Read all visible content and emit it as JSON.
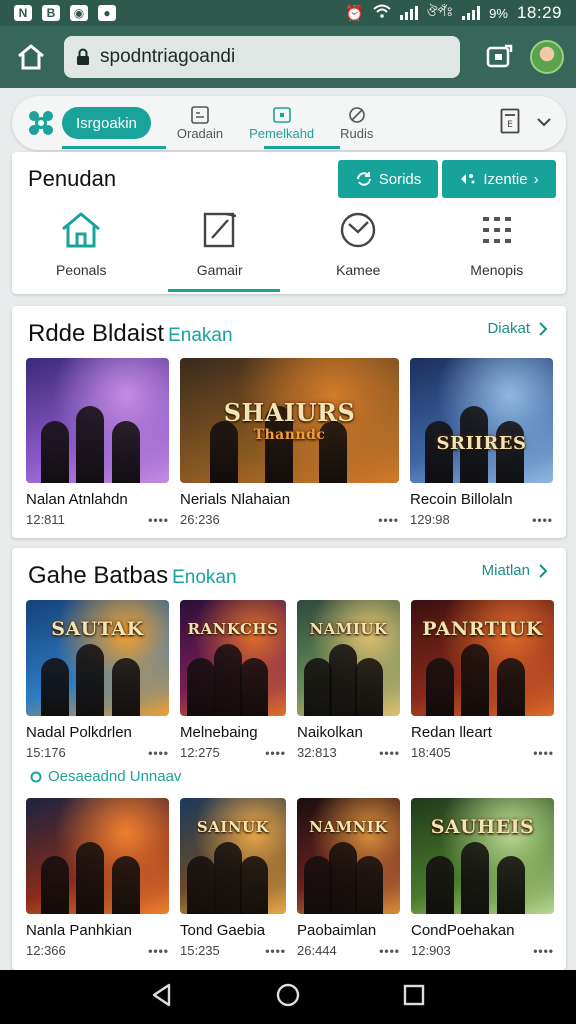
{
  "status_bar": {
    "left_icons": [
      "N",
      "B",
      "camera-icon",
      "chat-icon"
    ],
    "alarm": "alarm-icon",
    "carrier": "ঔপঁঃ",
    "battery": "9%",
    "time": "18:29"
  },
  "browser": {
    "url": "spodntriagoandi",
    "home_icon": "home-icon",
    "lock_icon": "lock-icon",
    "tabs_icon": "tab-switch-icon"
  },
  "top_nav": {
    "active_pill": "Isrgoakin",
    "tabs": [
      {
        "label": "Oradain",
        "icon": "grid-icon"
      },
      {
        "label": "Pemelkahd",
        "icon": "screen-icon"
      },
      {
        "label": "Rudis",
        "icon": "leaf-icon"
      }
    ]
  },
  "categories_card": {
    "title": "Penudan",
    "button_1": "Sorids",
    "button_2": "Izentie",
    "items": [
      {
        "label": "Peonals",
        "icon": "house-icon"
      },
      {
        "label": "Gamair",
        "icon": "pencil-icon"
      },
      {
        "label": "Kamee",
        "icon": "compass-icon"
      },
      {
        "label": "Menopis",
        "icon": "apps-grid-icon"
      }
    ]
  },
  "section_1": {
    "title": "Rdde Bldaist",
    "accent": "Enakan",
    "link": "Diakat",
    "items": [
      {
        "name": "Nalan Atnlahdn",
        "meta": "12:811",
        "thumb_text": "",
        "colors": [
          "#3b2a7a",
          "#8b5ac9",
          "#c58be0"
        ]
      },
      {
        "name": "Nerials Nlahaian",
        "meta": "26:236",
        "thumb_text": "SHAIURS",
        "thumb_sub": "Thanndc",
        "colors": [
          "#3a2a1c",
          "#8a5a22",
          "#d27a2a"
        ]
      },
      {
        "name": "Recoin Billolaln",
        "meta": "129:98",
        "thumb_text": "SRIIRES",
        "colors": [
          "#1c2f5c",
          "#3f67a7",
          "#90b9e0"
        ]
      }
    ]
  },
  "section_2": {
    "title": "Gahe Batbas",
    "accent": "Enokan",
    "link": "Miatlan",
    "sub_label": "Oesaeadnd Unnaav",
    "row_1": [
      {
        "name": "Nadal Polkdrlen",
        "meta": "15:176",
        "thumb_text": "SAUTAK",
        "colors": [
          "#15417a",
          "#2d7cc4",
          "#f0a030"
        ]
      },
      {
        "name": "Melnebaing",
        "meta": "12:275",
        "thumb_text": "RANKCHS",
        "colors": [
          "#2a1038",
          "#7a1f56",
          "#e0702a"
        ]
      },
      {
        "name": "Naikolkan",
        "meta": "32:813",
        "thumb_text": "NAMIUK",
        "colors": [
          "#2d4a3c",
          "#6a8a5a",
          "#e0c070"
        ]
      },
      {
        "name": "Redan lleart",
        "meta": "18:405",
        "thumb_text": "PANRTIUK",
        "colors": [
          "#3a1010",
          "#8a2a1a",
          "#e06a2a"
        ]
      }
    ],
    "row_2": [
      {
        "name": "Nanla Panhkian",
        "meta": "12:366",
        "thumb_text": "",
        "colors": [
          "#1a2440",
          "#8a2a1a",
          "#f08030"
        ]
      },
      {
        "name": "Tond Gaebia",
        "meta": "15:235",
        "thumb_text": "SAINUK",
        "colors": [
          "#1c3a5a",
          "#6a4a2a",
          "#e8a848"
        ]
      },
      {
        "name": "Paobaimlan",
        "meta": "26:444",
        "thumb_text": "NAMNIK",
        "colors": [
          "#1a1010",
          "#6a2020",
          "#d8903a"
        ]
      },
      {
        "name": "CondPoehakan",
        "meta": "12:903",
        "thumb_text": "SAUHEIS",
        "colors": [
          "#1f3a1c",
          "#4a7a2c",
          "#b8d890"
        ]
      }
    ]
  },
  "accent_color": "#1aa39a",
  "header_color": "#37665a"
}
